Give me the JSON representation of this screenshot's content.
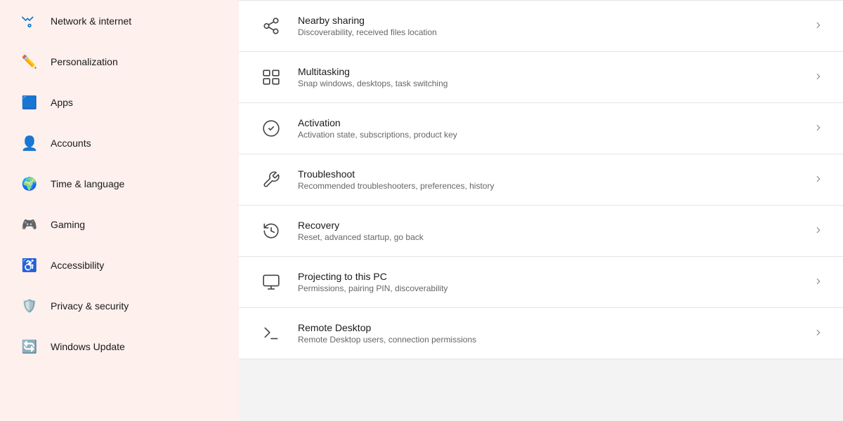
{
  "sidebar": {
    "items": [
      {
        "id": "network",
        "label": "Network & internet",
        "icon": "🌐",
        "color": "#0078d4"
      },
      {
        "id": "personalization",
        "label": "Personalization",
        "icon": "✏️",
        "color": "#e74856"
      },
      {
        "id": "apps",
        "label": "Apps",
        "icon": "🟦",
        "color": "#0078d4"
      },
      {
        "id": "accounts",
        "label": "Accounts",
        "icon": "👤",
        "color": "#0078d4"
      },
      {
        "id": "time",
        "label": "Time & language",
        "icon": "🌍",
        "color": "#0078d4"
      },
      {
        "id": "gaming",
        "label": "Gaming",
        "icon": "🎮",
        "color": "#0078d4"
      },
      {
        "id": "accessibility",
        "label": "Accessibility",
        "icon": "♿",
        "color": "#0078d4"
      },
      {
        "id": "privacy",
        "label": "Privacy & security",
        "icon": "🛡️",
        "color": "#444"
      },
      {
        "id": "update",
        "label": "Windows Update",
        "icon": "🔄",
        "color": "#0078d4"
      }
    ]
  },
  "settings": [
    {
      "id": "nearby-sharing",
      "title": "Nearby sharing",
      "desc": "Discoverability, received files location",
      "icon_type": "share"
    },
    {
      "id": "multitasking",
      "title": "Multitasking",
      "desc": "Snap windows, desktops, task switching",
      "icon_type": "multitasking"
    },
    {
      "id": "activation",
      "title": "Activation",
      "desc": "Activation state, subscriptions, product key",
      "icon_type": "activation"
    },
    {
      "id": "troubleshoot",
      "title": "Troubleshoot",
      "desc": "Recommended troubleshooters, preferences, history",
      "icon_type": "troubleshoot"
    },
    {
      "id": "recovery",
      "title": "Recovery",
      "desc": "Reset, advanced startup, go back",
      "icon_type": "recovery"
    },
    {
      "id": "projecting",
      "title": "Projecting to this PC",
      "desc": "Permissions, pairing PIN, discoverability",
      "icon_type": "projecting"
    },
    {
      "id": "remote-desktop",
      "title": "Remote Desktop",
      "desc": "Remote Desktop users, connection permissions",
      "icon_type": "remote"
    }
  ]
}
